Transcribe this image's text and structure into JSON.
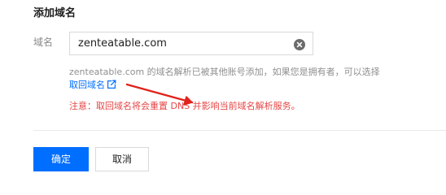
{
  "section_title": "添加域名",
  "form": {
    "domain_label": "域名",
    "domain_value": "zenteatable.com",
    "hint_text": "zenteatable.com 的域名解析已被其他账号添加，如果您是拥有者，可以选择",
    "reclaim_link_label": "取回域名",
    "warning_text": "注意：取回域名将会重置 DNS 并影响当前域名解析服务。"
  },
  "actions": {
    "confirm_label": "确定",
    "cancel_label": "取消"
  },
  "colors": {
    "accent": "#006eff",
    "warning": "#e54545",
    "annotation": "#e0231b"
  },
  "icons": {
    "clear": "clear-circle-icon",
    "external_link": "external-link-icon"
  }
}
